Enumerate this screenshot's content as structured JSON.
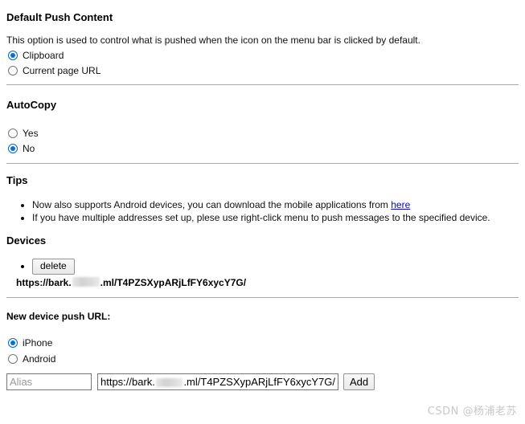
{
  "sections": {
    "default_push": {
      "title": "Default Push Content",
      "description": "This option is used to control what is pushed when the icon on the menu bar is clicked by default.",
      "options": [
        {
          "label": "Clipboard",
          "selected": true
        },
        {
          "label": "Current page URL",
          "selected": false
        }
      ]
    },
    "autocopy": {
      "title": "AutoCopy",
      "options": [
        {
          "label": "Yes",
          "selected": false
        },
        {
          "label": "No",
          "selected": true
        }
      ]
    },
    "tips": {
      "title": "Tips",
      "items": [
        {
          "text_before": "Now also supports Android devices, you can download the mobile applications from ",
          "link_text": "here",
          "text_after": ""
        },
        {
          "text_before": "If you have multiple addresses set up, plese use right-click menu to push messages to the specified device.",
          "link_text": "",
          "text_after": ""
        }
      ]
    },
    "devices": {
      "title": "Devices",
      "entries": [
        {
          "delete_label": "delete",
          "url_prefix": "https://bark.",
          "url_suffix": ".ml/T4PZSXypARjLfFY6xycY7G/"
        }
      ]
    },
    "new_device": {
      "title": "New device push URL:",
      "platform_options": [
        {
          "label": "iPhone",
          "selected": true
        },
        {
          "label": "Android",
          "selected": false
        }
      ],
      "alias_placeholder": "Alias",
      "alias_value": "",
      "url_prefix": "https://bark.",
      "url_suffix": ".ml/T4PZSXypARjLfFY6xycY7G/",
      "add_label": "Add"
    }
  },
  "watermark": "CSDN @杨浦老苏",
  "colors": {
    "accent": "#0a6fd8",
    "link": "#0000ee",
    "divider": "#a9a9a9"
  }
}
